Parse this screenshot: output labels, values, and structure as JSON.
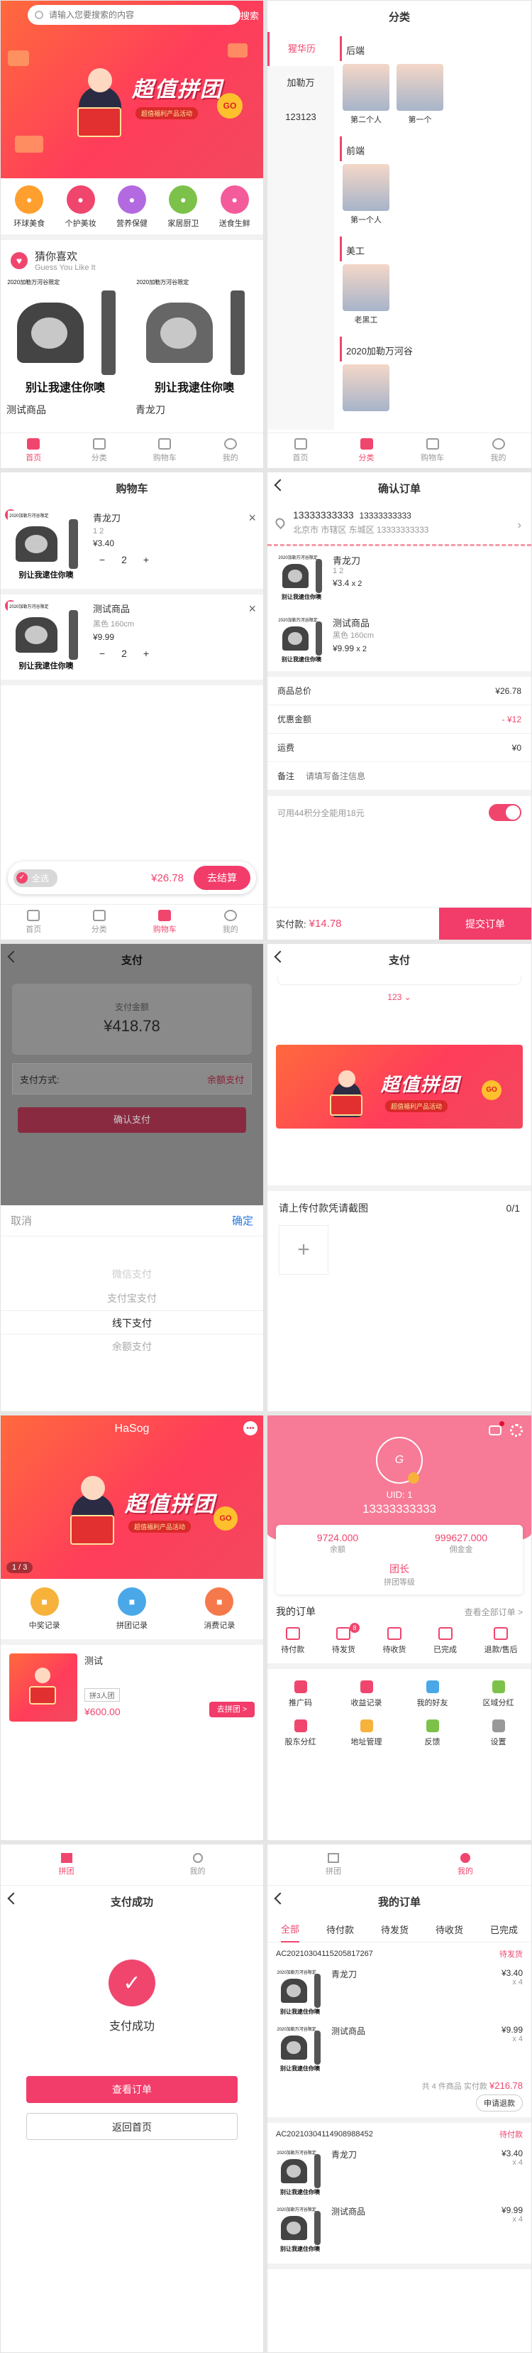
{
  "home": {
    "search_placeholder": "请输入您要搜索的内容",
    "search_button": "搜索",
    "banner": {
      "title": "超值拼团",
      "subtitle": "超值福利产品活动",
      "go": "GO"
    },
    "categories": [
      {
        "label": "环球美食",
        "color": "#ff9f2e"
      },
      {
        "label": "个护美妆",
        "color": "#f0466e"
      },
      {
        "label": "营养保健",
        "color": "#b36ae0"
      },
      {
        "label": "家居厨卫",
        "color": "#7cc24a"
      },
      {
        "label": "送食生鲜",
        "color": "#f45b9b"
      }
    ],
    "guess": {
      "title": "猜你喜欢",
      "subtitle": "Guess You Like It"
    },
    "meme_top": "2020加勒万河谷限定",
    "meme_caption": "别让我逮住你噢",
    "products": [
      {
        "name": "测试商品"
      },
      {
        "name": "青龙刀"
      }
    ]
  },
  "tabs": {
    "home": "首页",
    "category": "分类",
    "cart": "购物车",
    "mine": "我的"
  },
  "category": {
    "title": "分类",
    "left": [
      "猩华历",
      "加勒万",
      "123123"
    ],
    "sections": [
      {
        "name": "后端",
        "items": [
          "第二个人",
          "第一个"
        ]
      },
      {
        "name": "前端",
        "items": [
          "第一个人"
        ]
      },
      {
        "name": "美工",
        "items": [
          "老黑工"
        ]
      },
      {
        "name": "2020加勒万河谷",
        "items": [
          ""
        ]
      }
    ]
  },
  "cart": {
    "title": "购物车",
    "items": [
      {
        "name": "青龙刀",
        "spec": "1 2",
        "price": "¥3.40",
        "qty": "2"
      },
      {
        "name": "测试商品",
        "spec": "黑色 160cm",
        "price": "¥9.99",
        "qty": "2"
      }
    ],
    "select_all": "全选",
    "total": "¥26.78",
    "checkout": "去结算"
  },
  "confirm": {
    "title": "确认订单",
    "phone1": "13333333333",
    "phone2": "13333333333",
    "address": "北京市 市辖区 东城区 13333333333",
    "items": [
      {
        "name": "青龙刀",
        "spec": "1 2",
        "price": "¥3.4",
        "qty": "x 2"
      },
      {
        "name": "测试商品",
        "spec": "黑色 160cm",
        "price": "¥9.99",
        "qty": "x 2"
      }
    ],
    "goods_total_label": "商品总价",
    "goods_total": "¥26.78",
    "discount_label": "优惠金额",
    "discount": "- ¥12",
    "freight_label": "运费",
    "freight": "¥0",
    "remark_label": "备注",
    "remark_placeholder": "请填写备注信息",
    "points": "可用44积分全能用18元",
    "paid_label": "实付款:",
    "paid": "¥14.78",
    "submit": "提交订单"
  },
  "pay": {
    "title": "支付",
    "amount_label": "支付金额",
    "amount": "¥418.78",
    "method_label": "支付方式:",
    "method_value": "余额支付",
    "confirm_btn": "确认支付",
    "picker_cancel": "取消",
    "picker_ok": "确定",
    "options": [
      "微信支付",
      "支付宝支付",
      "线下支付",
      "余额支付"
    ]
  },
  "pay2": {
    "title": "支付",
    "value": "123",
    "upload_label": "请上传付款凭请截图",
    "upload_count": "0/1"
  },
  "group": {
    "title": "HaSog",
    "page": "1 / 3",
    "links": [
      {
        "label": "中奖记录",
        "color": "#f7b23b"
      },
      {
        "label": "拼团记录",
        "color": "#4aa8e8"
      },
      {
        "label": "消费记录",
        "color": "#f5794a"
      }
    ],
    "product": {
      "name": "测试",
      "tag": "拼3人团",
      "price": "¥600.00",
      "btn": "去拼团 >"
    }
  },
  "mine": {
    "uid": "UID: 1",
    "phone": "13333333333",
    "balance": "9724.000",
    "balance_label": "余额",
    "commission": "999627.000",
    "commission_label": "佣金金",
    "level": "团长",
    "level_label": "拼团等级",
    "orders_title": "我的订单",
    "orders_all": "查看全部订单 >",
    "order_icons": [
      {
        "label": "待付款",
        "badge": ""
      },
      {
        "label": "待发货",
        "badge": "8"
      },
      {
        "label": "待收货",
        "badge": ""
      },
      {
        "label": "已完成",
        "badge": ""
      },
      {
        "label": "退款/售后",
        "badge": ""
      }
    ],
    "tools": [
      {
        "label": "推广码",
        "color": "#f0466e"
      },
      {
        "label": "收益记录",
        "color": "#f0466e"
      },
      {
        "label": "我的好友",
        "color": "#4aa8e8"
      },
      {
        "label": "区域分红",
        "color": "#7cc24a"
      },
      {
        "label": "股东分红",
        "color": "#f0466e"
      },
      {
        "label": "地址管理",
        "color": "#f7b23b"
      },
      {
        "label": "反馈",
        "color": "#7cc24a"
      },
      {
        "label": "设置",
        "color": "#999999"
      }
    ]
  },
  "success": {
    "title": "支付成功",
    "text": "支付成功",
    "view_order": "查看订单",
    "back_home": "返回首页",
    "tab_group": "拼团",
    "tab_mine": "我的"
  },
  "orders": {
    "title": "我的订单",
    "tabs": [
      "全部",
      "待付款",
      "待发货",
      "待收货",
      "已完成"
    ],
    "list": [
      {
        "no": "AC20210304115205817267",
        "status": "待发货",
        "items": [
          {
            "name": "青龙刀",
            "price": "¥3.40",
            "qty": "x 4"
          },
          {
            "name": "测试商品",
            "price": "¥9.99",
            "qty": "x 4"
          }
        ],
        "summary": "共 4 件商品 实付款",
        "total": "¥216.78",
        "action": "申请退款"
      },
      {
        "no": "AC20210304114908988452",
        "status": "待付款",
        "items": [
          {
            "name": "青龙刀",
            "price": "¥3.40",
            "qty": "x 4"
          },
          {
            "name": "测试商品",
            "price": "¥9.99",
            "qty": "x 4"
          }
        ]
      }
    ]
  },
  "colors": {
    "accent": "#f0466e",
    "header_pink": "#f77a96"
  }
}
